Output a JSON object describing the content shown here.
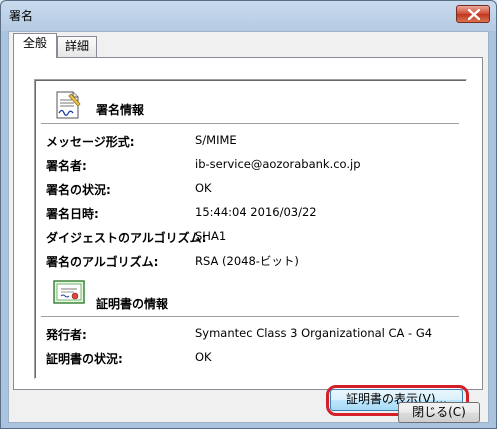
{
  "window": {
    "title": "署名"
  },
  "tabs": [
    {
      "label": "全般",
      "active": true
    },
    {
      "label": "詳細",
      "active": false
    }
  ],
  "signature": {
    "section_title": "署名情報",
    "rows": [
      {
        "label": "メッセージ形式:",
        "value": "S/MIME"
      },
      {
        "label": "署名者:",
        "value": "ib-service@aozorabank.co.jp"
      },
      {
        "label": "署名の状況:",
        "value": "OK"
      },
      {
        "label": "署名日時:",
        "value": "15:44:04 2016/03/22"
      },
      {
        "label": "ダイジェストのアルゴリズム:",
        "value": "SHA1"
      },
      {
        "label": "署名のアルゴリズム:",
        "value": "RSA (2048-ビット)"
      }
    ]
  },
  "certificate": {
    "section_title": "証明書の情報",
    "rows": [
      {
        "label": "発行者:",
        "value": "Symantec Class 3 Organizational CA - G4"
      },
      {
        "label": "証明書の状況:",
        "value": "OK"
      }
    ]
  },
  "buttons": {
    "view_certificate": "証明書の表示(V)...",
    "close": "閉じる(C)"
  },
  "colors": {
    "highlight": "#d21f2a",
    "titlebar": "#c9dbee",
    "close_button": "#d24a33"
  },
  "icons": {
    "signature": "document-signature-icon",
    "certificate": "certificate-icon",
    "close": "close-icon"
  }
}
